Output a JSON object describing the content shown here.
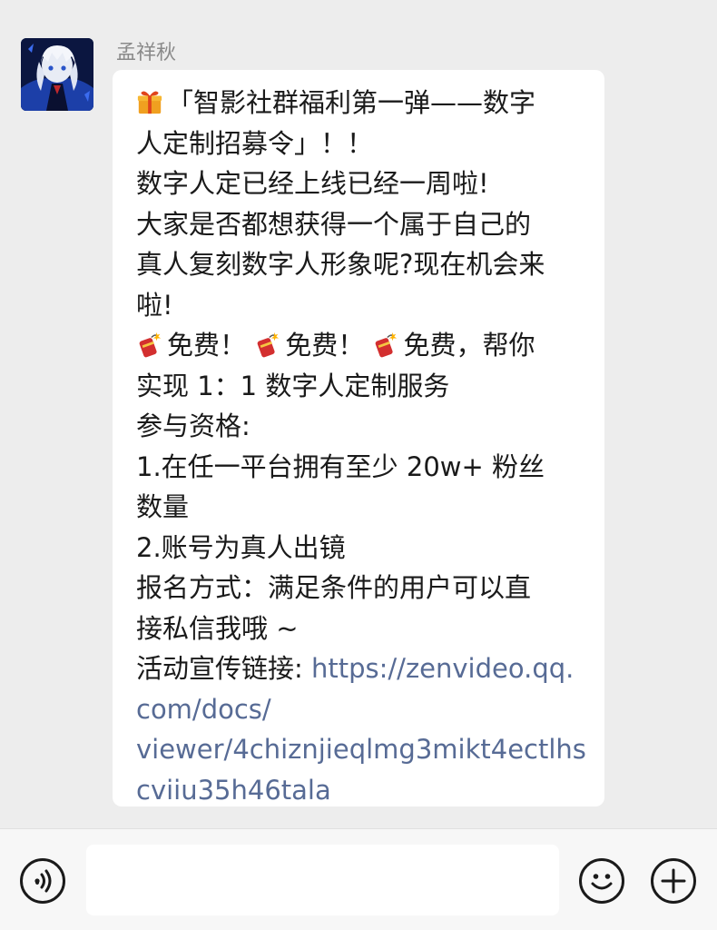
{
  "chat": {
    "sender_name": "孟祥秋",
    "message": {
      "line1": "「智影社群福利第一弹——数字",
      "line2": "人定制招募令」！！",
      "line3": "数字人定已经上线已经一周啦!",
      "line4": "大家是否都想获得一个属于自己的",
      "line5": "真人复刻数字人形象呢?现在机会来",
      "line6": "啦!",
      "free1": "免费！",
      "free2": "免费！",
      "free3": "免费，帮你",
      "line8": "实现 1：1 数字人定制服务",
      "line9": "参与资格:",
      "line10": "1.在任一平台拥有至少 20w+ 粉丝",
      "line11": "数量",
      "line12": "2.账号为真人出镜",
      "line13": "报名方式：满足条件的用户可以直",
      "line14": "接私信我哦 ~",
      "link_prefix": "活动宣传链接: ",
      "link_part1": "https://zenvideo.qq.",
      "link_part2": "com/docs/",
      "link_part3": "viewer/4chiznjieqlmg3mikt4ectlhs",
      "link_part4": "cviiu35h46tala"
    },
    "icons": [
      "gift-icon",
      "firecracker-icon"
    ]
  },
  "input_bar": {
    "text_value": "",
    "icons": [
      "voice-icon",
      "emoji-icon",
      "add-icon"
    ]
  },
  "colors": {
    "background": "#ededed",
    "bubble": "#ffffff",
    "link": "#576b95",
    "sender_name": "#8a8a8a"
  }
}
